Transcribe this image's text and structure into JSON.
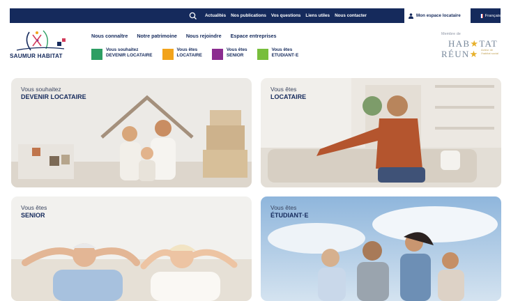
{
  "topbar": {
    "links": [
      "Actualités",
      "Nos publications",
      "Vos questions",
      "Liens utiles",
      "Nous contacter"
    ],
    "account_label": "Mon espace locataire",
    "language_label": "Français"
  },
  "logo": {
    "brand": "SAUMUR HABITAT"
  },
  "mainnav": [
    "Nous connaître",
    "Notre patrimoine",
    "Nous rejoindre",
    "Espace entreprises"
  ],
  "shortcuts": [
    {
      "line1": "Vous souhaitez",
      "line2": "DEVENIR LOCATAIRE",
      "color": "#2d9e63"
    },
    {
      "line1": "Vous êtes",
      "line2": "LOCATAIRE",
      "color": "#f2a31b"
    },
    {
      "line1": "Vous êtes",
      "line2": "SENIOR",
      "color": "#8b2c8f"
    },
    {
      "line1": "Vous êtes",
      "line2": "ETUDIANT·E",
      "color": "#78be3c"
    }
  ],
  "member": {
    "pre": "Membre de",
    "hab": "HAB",
    "tat": "TAT",
    "reun": "RÉUN",
    "tagline": "Acteur de l'habitat social"
  },
  "cards": [
    {
      "line1": "Vous souhaitez",
      "line2": "DEVENIR LOCATAIRE"
    },
    {
      "line1": "Vous êtes",
      "line2": "LOCATAIRE"
    },
    {
      "line1": "Vous êtes",
      "line2": "SENIOR"
    },
    {
      "line1": "Vous êtes",
      "line2": "ÉTUDIANT·E"
    }
  ],
  "colors": {
    "navy": "#152a5c",
    "green": "#2d9e63",
    "orange": "#f2a31b",
    "purple": "#8b2c8f",
    "lime": "#78be3c"
  }
}
